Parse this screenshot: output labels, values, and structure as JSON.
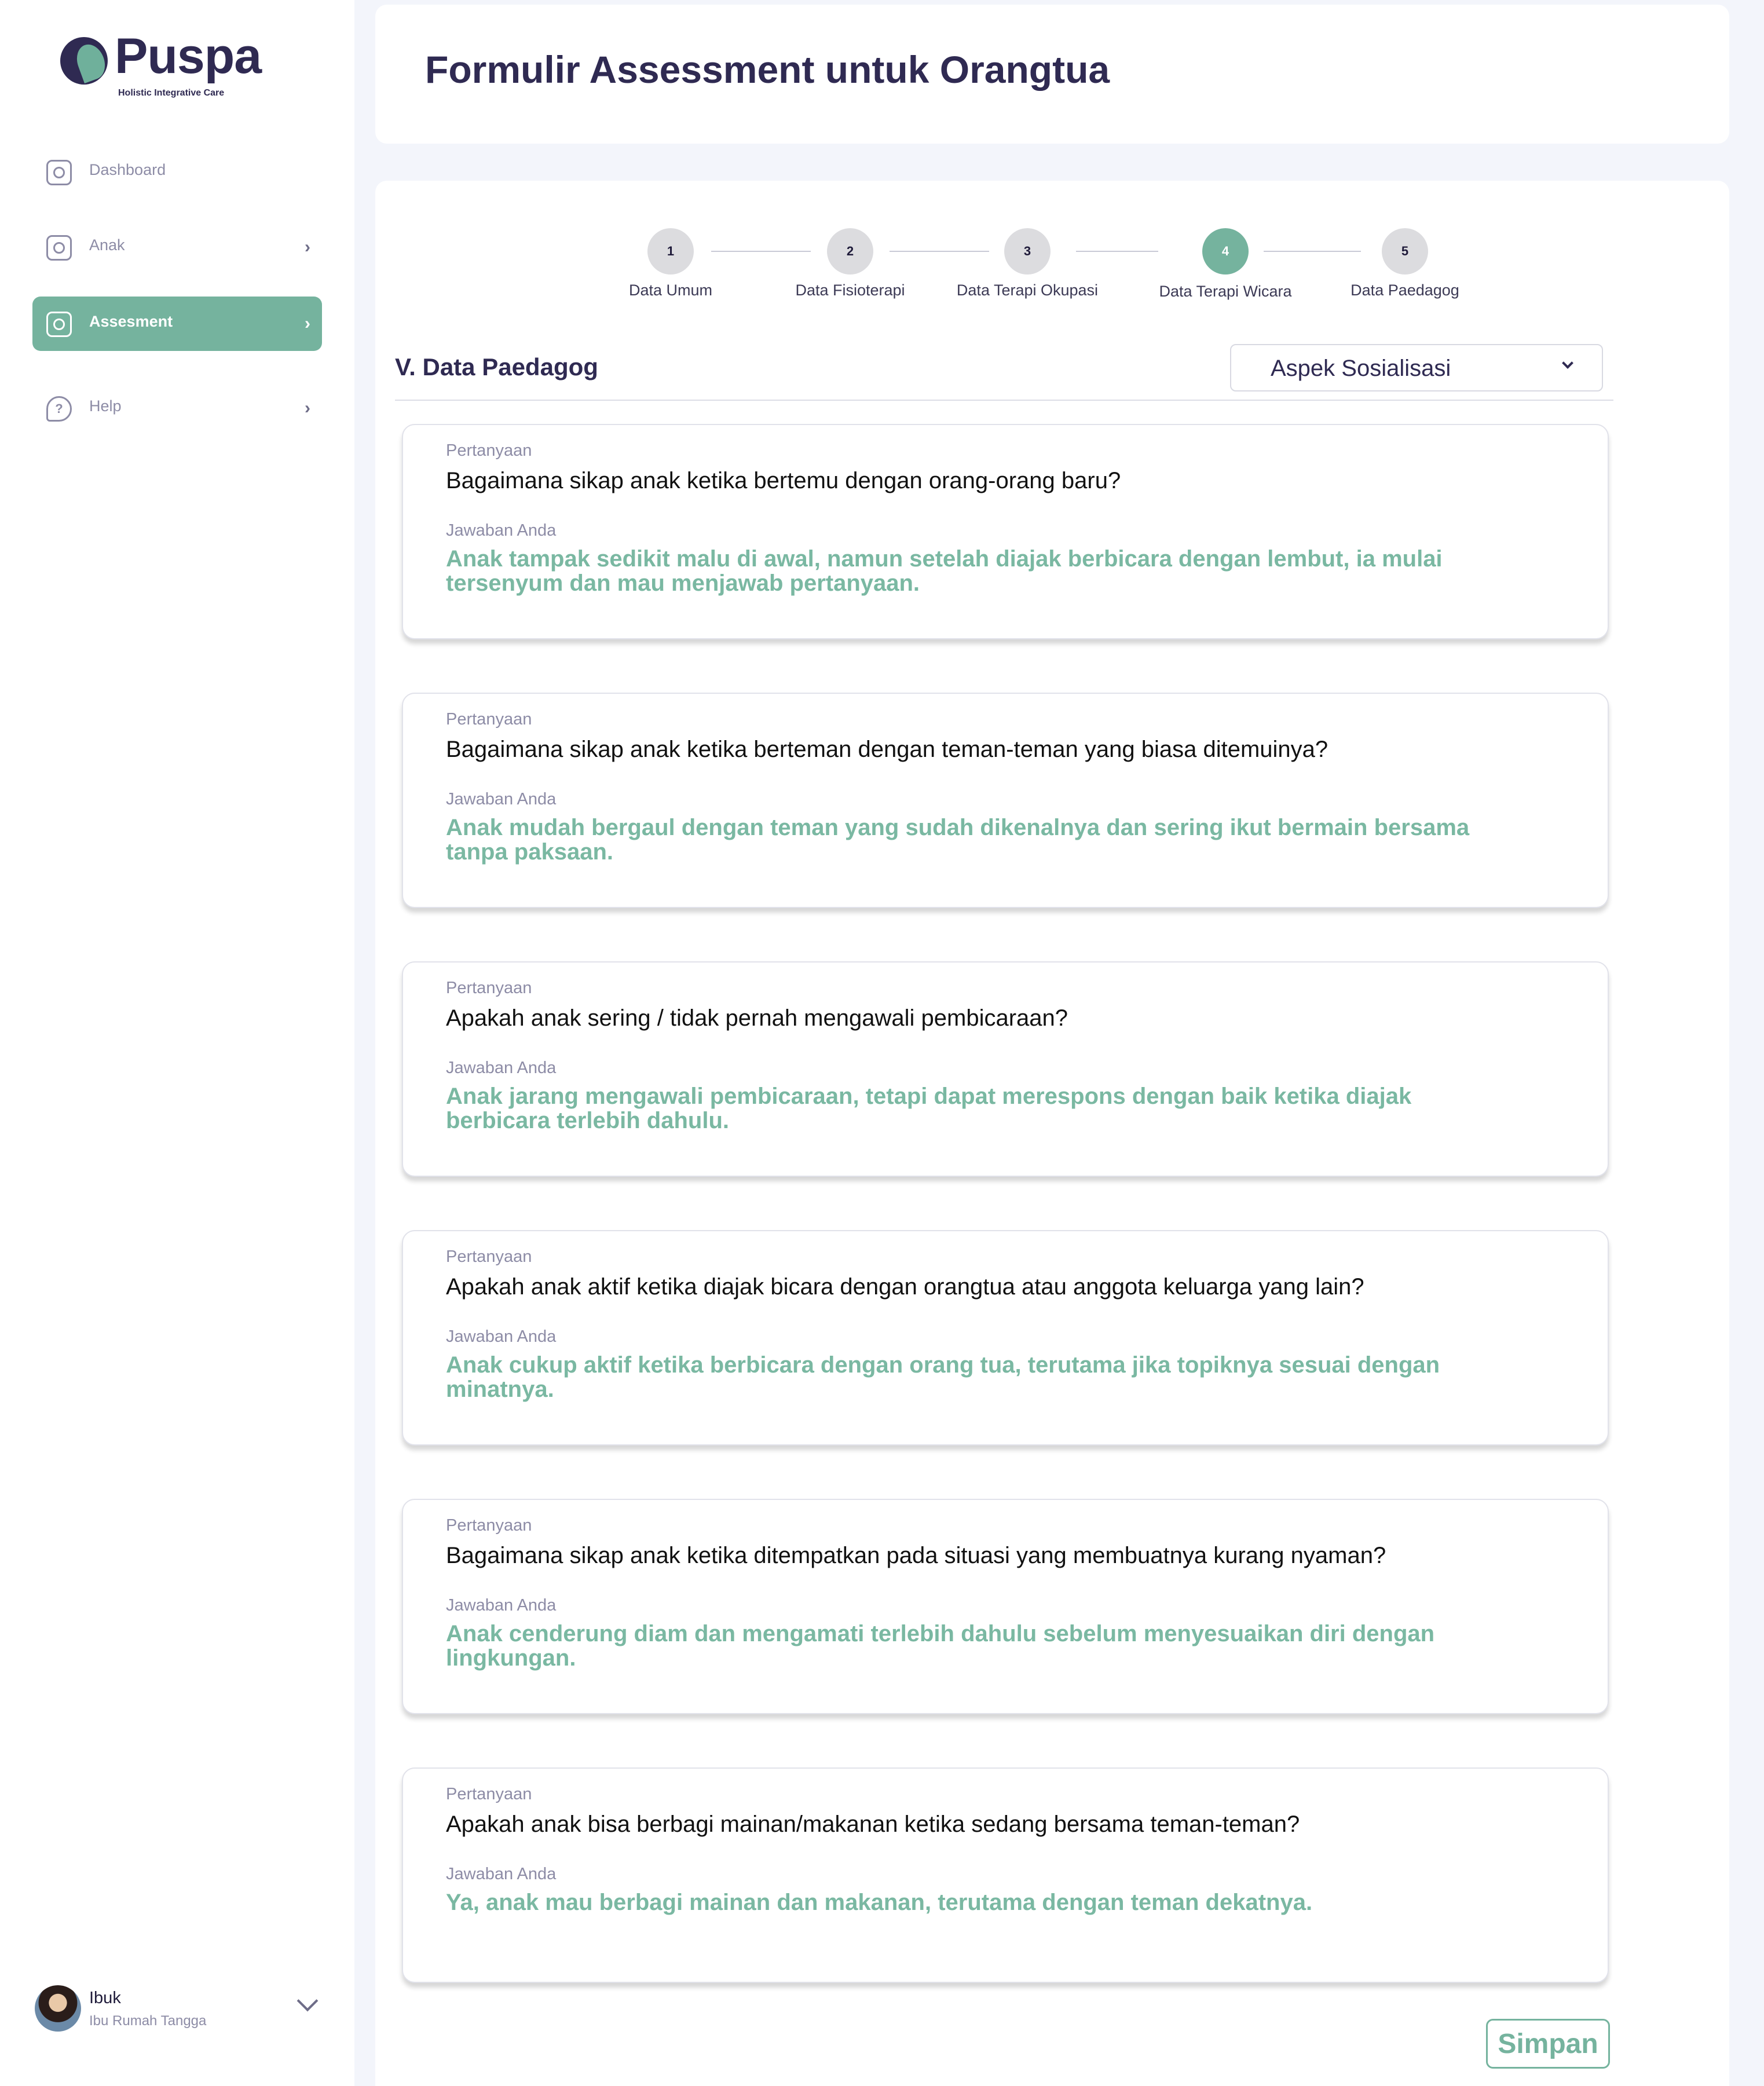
{
  "app": {
    "logo_name": "Puspa",
    "logo_tagline": "Holistic Integrative Care"
  },
  "sidebar": {
    "items": [
      {
        "label": "Dashboard",
        "icon": "dashboard-icon",
        "active": false,
        "has_chevron": false
      },
      {
        "label": "Anak",
        "icon": "child-face-icon",
        "active": false,
        "has_chevron": true
      },
      {
        "label": "Assesment",
        "icon": "assessment-user-icon",
        "active": true,
        "has_chevron": true
      },
      {
        "label": "Help",
        "icon": "help-question-icon",
        "active": false,
        "has_chevron": true
      }
    ]
  },
  "profile": {
    "name": "Ibuk",
    "role": "Ibu Rumah Tangga"
  },
  "header": {
    "title": "Formulir Assessment untuk Orangtua"
  },
  "stepper": {
    "steps": [
      {
        "number": "1",
        "label": "Data Umum",
        "active": false
      },
      {
        "number": "2",
        "label": "Data Fisioterapi",
        "active": false
      },
      {
        "number": "3",
        "label": "Data Terapi Okupasi",
        "active": false
      },
      {
        "number": "4",
        "label": "Data Terapi Wicara",
        "active": true
      },
      {
        "number": "5",
        "label": "Data Paedagog",
        "active": false
      }
    ]
  },
  "section": {
    "title": "V. Data Paedagog",
    "aspect_selected": "Aspek Sosialisasi"
  },
  "qa": {
    "question_label": "Pertanyaan",
    "answer_label": "Jawaban Anda",
    "items": [
      {
        "question": "Bagaimana sikap anak ketika bertemu dengan orang-orang baru?",
        "answer": "Anak tampak sedikit malu di awal, namun setelah diajak berbicara dengan lembut, ia mulai tersenyum dan mau menjawab pertanyaan."
      },
      {
        "question": "Bagaimana sikap anak ketika berteman dengan teman-teman yang biasa ditemuinya?",
        "answer": "Anak mudah bergaul dengan teman yang sudah dikenalnya dan sering ikut bermain bersama tanpa paksaan."
      },
      {
        "question": "Apakah anak sering / tidak pernah mengawali pembicaraan?",
        "answer": "Anak jarang mengawali pembicaraan, tetapi dapat merespons dengan baik ketika diajak berbicara terlebih dahulu."
      },
      {
        "question": "Apakah anak aktif ketika diajak bicara dengan orangtua atau anggota keluarga yang lain?",
        "answer": "Anak cukup aktif ketika berbicara dengan orang tua, terutama jika topiknya sesuai dengan minatnya."
      },
      {
        "question": "Bagaimana sikap anak ketika ditempatkan pada situasi yang membuatnya kurang nyaman?",
        "answer": "Anak cenderung diam dan mengamati terlebih dahulu sebelum menyesuaikan diri dengan lingkungan."
      },
      {
        "question": "Apakah anak bisa berbagi mainan/makanan ketika sedang bersama teman-teman?",
        "answer": "Ya, anak mau berbagi mainan dan makanan, terutama dengan teman dekatnya."
      }
    ]
  },
  "actions": {
    "save_label": "Simpan"
  },
  "colors": {
    "accent": "#75b39e",
    "brand_dark": "#2f2a52",
    "page_bg": "#f3f5fb"
  }
}
